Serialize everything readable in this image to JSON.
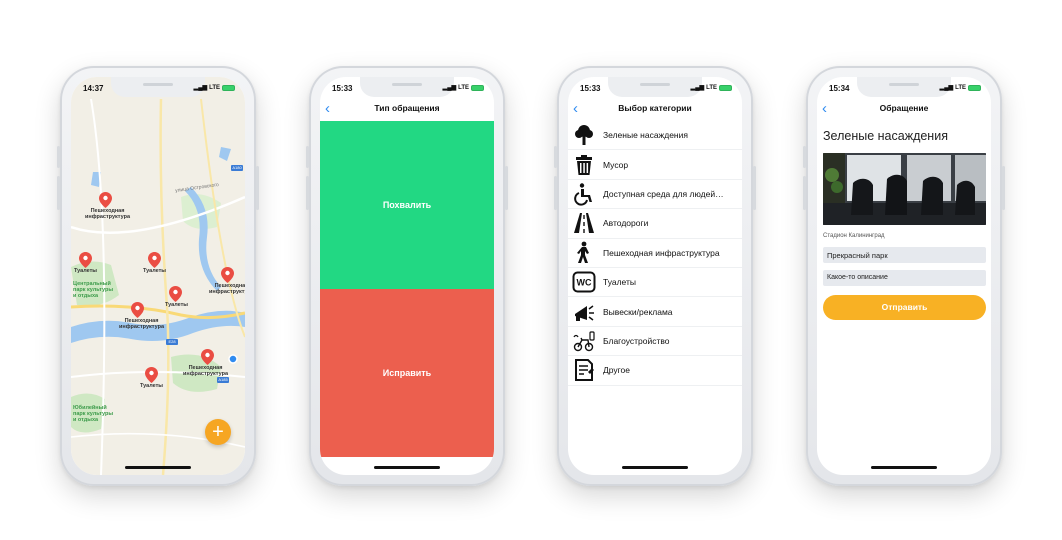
{
  "phones": [
    {
      "time": "14:37",
      "network": "LTE",
      "map": {
        "street_label": "улица Островского",
        "road_badges": [
          "A180",
          "E28",
          "A185"
        ],
        "pins": [
          {
            "label": "Пешеходная\nинфраструктура"
          },
          {
            "label": "Туалеты"
          },
          {
            "label": "Туалеты"
          },
          {
            "label": "Туалеты"
          },
          {
            "label": "Пешеходная\nинфраструктура"
          },
          {
            "label": "Пешеходная\nинфраструктура"
          },
          {
            "label": "Туалеты"
          },
          {
            "label": "Пешеходная\nинфраструктура"
          }
        ],
        "park_labels": [
          "Центральный\nпарк культуры\nи отдыха",
          "Юбилейный\nпарк культуры\nи отдыха"
        ],
        "fab_label": "+"
      }
    },
    {
      "time": "15:33",
      "network": "LTE",
      "title": "Тип обращения",
      "praise": "Похвалить",
      "fix": "Исправить"
    },
    {
      "time": "15:33",
      "network": "LTE",
      "title": "Выбор категории",
      "categories": [
        {
          "label": "Зеленые насаждения",
          "icon": "tree-icon"
        },
        {
          "label": "Мусор",
          "icon": "trash-icon"
        },
        {
          "label": "Доступная среда для людей…",
          "icon": "wheelchair-icon"
        },
        {
          "label": "Автодороги",
          "icon": "road-icon"
        },
        {
          "label": "Пешеходная инфраструктура",
          "icon": "pedestrian-icon"
        },
        {
          "label": "Туалеты",
          "icon": "wc-icon"
        },
        {
          "label": "Вывески/реклама",
          "icon": "megaphone-icon"
        },
        {
          "label": "Благоустройство",
          "icon": "bench-icon"
        },
        {
          "label": "Другое",
          "icon": "document-icon"
        }
      ]
    },
    {
      "time": "15:34",
      "network": "LTE",
      "title": "Обращение",
      "heading": "Зеленые насаждения",
      "photo_caption": "Стадион Калининград",
      "name_value": "Прекрасный парк",
      "description_value": "Какое-то описание",
      "submit": "Отправить"
    }
  ],
  "colors": {
    "accent_blue": "#2f8bf0",
    "praise_green": "#22d883",
    "fix_red": "#ec5f4e",
    "submit_yellow": "#f8b124",
    "pin_red": "#ea4d43"
  }
}
